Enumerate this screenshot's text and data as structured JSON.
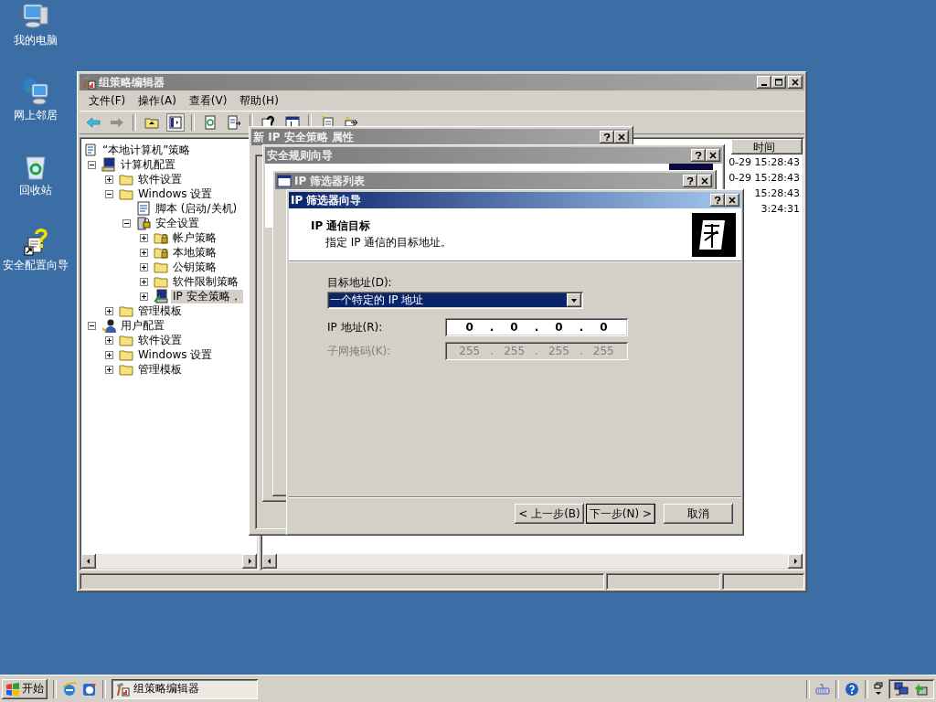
{
  "desktop_icons": [
    {
      "label": "我的电脑",
      "kind": "computer"
    },
    {
      "label": "网上邻居",
      "kind": "network"
    },
    {
      "label": "回收站",
      "kind": "recycle"
    },
    {
      "label": "安全配置向导",
      "kind": "wizard"
    }
  ],
  "window": {
    "title": "组策略编辑器",
    "active": false,
    "menu": [
      "文件(F)",
      "操作(A)",
      "查看(V)",
      "帮助(H)"
    ],
    "tree": [
      {
        "label": "“本地计算机”策略",
        "kind": "policy",
        "selected": false,
        "children": [
          {
            "label": "计算机配置",
            "kind": "computer",
            "selected": false,
            "expanded": true,
            "children": [
              {
                "label": "软件设置",
                "kind": "folder",
                "selected": false,
                "expanded": false
              },
              {
                "label": "Windows 设置",
                "kind": "folder",
                "selected": false,
                "expanded": true,
                "children": [
                  {
                    "label": "脚本 (启动/关机)",
                    "kind": "script",
                    "selected": false
                  },
                  {
                    "label": "安全设置",
                    "kind": "security",
                    "selected": false,
                    "expanded": true,
                    "children": [
                      {
                        "label": "帐户策略",
                        "kind": "lockfolder",
                        "selected": false,
                        "expanded": false
                      },
                      {
                        "label": "本地策略",
                        "kind": "lockfolder",
                        "selected": false,
                        "expanded": false
                      },
                      {
                        "label": "公钥策略",
                        "kind": "folder",
                        "selected": false,
                        "expanded": false
                      },
                      {
                        "label": "软件限制策略",
                        "kind": "folder",
                        "selected": false,
                        "expanded": false
                      },
                      {
                        "label": "IP 安全策略，",
                        "kind": "ipsec",
                        "selected": true,
                        "expanded": false
                      }
                    ]
                  }
                ]
              },
              {
                "label": "管理模板",
                "kind": "folder",
                "selected": false,
                "expanded": false
              }
            ]
          },
          {
            "label": "用户配置",
            "kind": "user",
            "selected": false,
            "expanded": true,
            "children": [
              {
                "label": "软件设置",
                "kind": "folder",
                "selected": false,
                "expanded": false
              },
              {
                "label": "Windows 设置",
                "kind": "folder",
                "selected": false,
                "expanded": false
              },
              {
                "label": "管理模板",
                "kind": "folder",
                "selected": false,
                "expanded": false
              }
            ]
          }
        ]
      }
    ],
    "list": {
      "columns": [
        "时间"
      ],
      "rows": [
        "0-29 15:28:43",
        "0-29 15:28:43",
        "15:28:43",
        "3:24:31"
      ]
    }
  },
  "dialogs": [
    {
      "title": "新 IP 安全策略 属性",
      "active": false,
      "kind": "plain"
    },
    {
      "title": "安全规则向导",
      "active": false,
      "kind": "wizard"
    },
    {
      "title": "IP 筛选器列表",
      "active": false,
      "kind": "list"
    }
  ],
  "wizard": {
    "title": "IP 筛选器向导",
    "active": true,
    "heading": "IP 通信目标",
    "subheading": "指定 IP 通信的目标地址。",
    "fields": [
      {
        "kind": "select",
        "label": "目标地址(D):",
        "value": "一个特定的 IP 地址",
        "disabled": false
      },
      {
        "kind": "ip",
        "label": "IP 地址(R):",
        "parts": [
          "0",
          ".",
          "0",
          ".",
          "0",
          ".",
          "0"
        ],
        "disabled": false
      },
      {
        "kind": "ip",
        "label": "子网掩码(K):",
        "parts": [
          "255",
          ".",
          "255",
          ".",
          "255",
          ".",
          "255"
        ],
        "disabled": true
      }
    ],
    "buttons": [
      {
        "label": "< 上一步(B)",
        "default": false
      },
      {
        "label": "下一步(N) >",
        "default": true
      },
      {
        "label": "取消",
        "default": false
      }
    ]
  },
  "taskbar": {
    "start": "开始",
    "tasks": [
      {
        "label": "组策略编辑器",
        "selected": true
      }
    ]
  }
}
